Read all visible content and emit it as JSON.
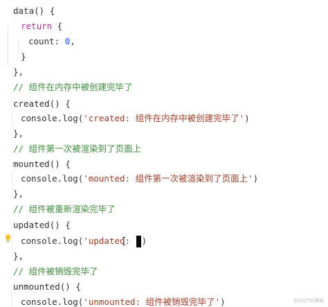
{
  "code": {
    "l1": {
      "fn": "data",
      "paren": "()",
      "brace": " {"
    },
    "l2": {
      "kw": "return",
      "brace": " {"
    },
    "l3": {
      "prop": "count:",
      "num": "0",
      "comma": ","
    },
    "l4": {
      "text": "}"
    },
    "l5": {
      "text": "},"
    },
    "l6": {
      "text": "// 组件在内存中被创建完毕了"
    },
    "l7": {
      "fn": "created",
      "paren": "()",
      "brace": " {"
    },
    "l8": {
      "obj": "console.log(",
      "str": "'created: 组件在内存中被创建完毕了'",
      "close": ")"
    },
    "l9": {
      "text": "},"
    },
    "l10": {
      "text": "// 组件第一次被渲染到了页面上"
    },
    "l11": {
      "fn": "mounted",
      "paren": "()",
      "brace": " {"
    },
    "l12": {
      "obj": "console.log(",
      "str": "'mounted: 组件第一次被渲染到了页面上'",
      "close": ")"
    },
    "l13": {
      "text": "},"
    },
    "l14": {
      "text": "// 组件被重新渲染完毕了"
    },
    "l15": {
      "fn": "updated",
      "paren": "()",
      "brace": " {"
    },
    "l16": {
      "obj": "console.log(",
      "str": "'updated: ",
      "close": ")"
    },
    "l17": {
      "text": "},"
    },
    "l18": {
      "text": "// 组件被销毁完毕了"
    },
    "l19": {
      "fn": "unmounted",
      "paren": "()",
      "brace": " {"
    },
    "l20": {
      "obj": "console.log(",
      "str": "'unmounted: 组件被销毁完毕了'",
      "close": ")"
    }
  },
  "watermark": "@51CTO博客",
  "icons": {
    "lightbulb": "lightbulb-icon",
    "text_cursor": "text-cursor-icon"
  },
  "colors": {
    "keyword": "#b12a91",
    "number": "#1750eb",
    "string": "#9a3a26",
    "comment": "#3c8a3c",
    "bulb": "#f2c233"
  }
}
